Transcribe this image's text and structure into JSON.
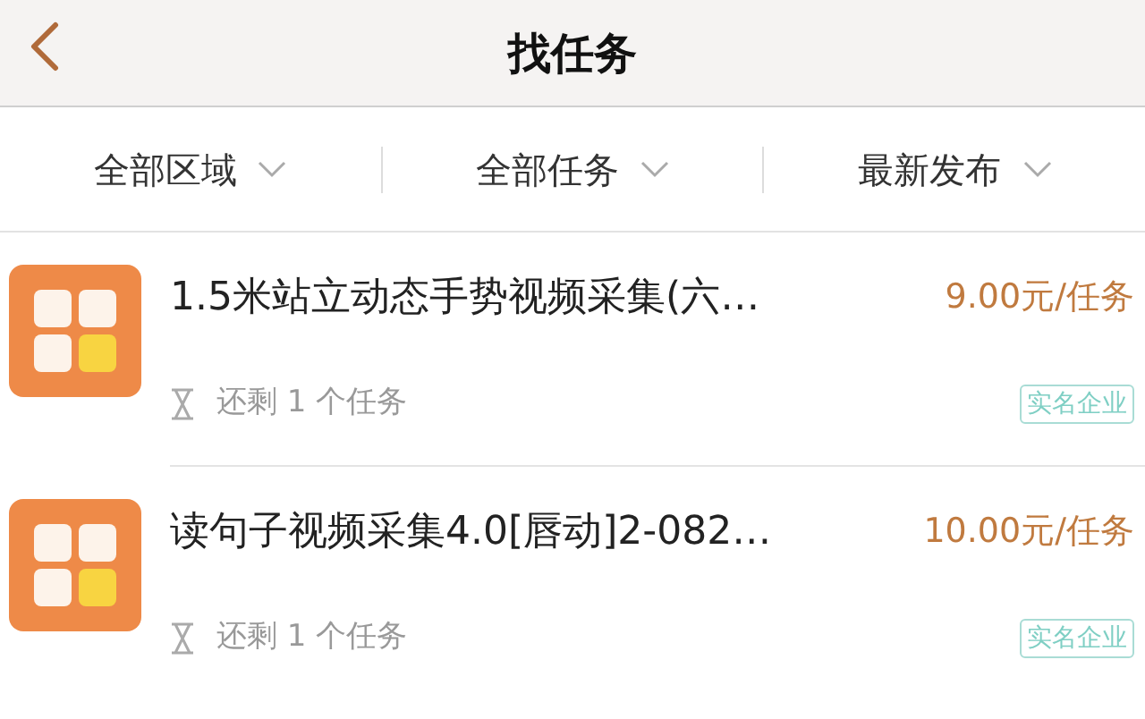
{
  "header": {
    "title": "找任务"
  },
  "filters": [
    {
      "label": "全部区域"
    },
    {
      "label": "全部任务"
    },
    {
      "label": "最新发布"
    }
  ],
  "tasks": [
    {
      "title": "1.5米站立动态手势视频采集(六…",
      "price": "9.00元/任务",
      "remaining": "还剩 1 个任务",
      "badge": "实名企业"
    },
    {
      "title": "读句子视频采集4.0[唇动]2-082…",
      "price": "10.00元/任务",
      "remaining": "还剩 1 个任务",
      "badge": "实名企业"
    }
  ]
}
